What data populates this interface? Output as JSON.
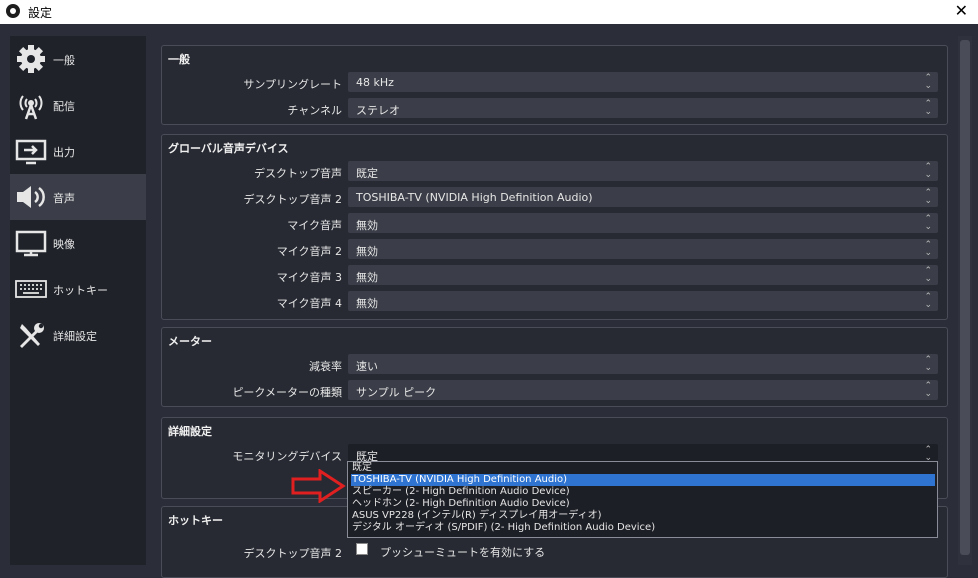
{
  "window": {
    "title": "設定",
    "close_label": "✕"
  },
  "sidebar": {
    "items": [
      {
        "label": "一般",
        "icon": "gear-icon"
      },
      {
        "label": "配信",
        "icon": "broadcast-icon"
      },
      {
        "label": "出力",
        "icon": "output-icon"
      },
      {
        "label": "音声",
        "icon": "speaker-icon"
      },
      {
        "label": "映像",
        "icon": "monitor-icon"
      },
      {
        "label": "ホットキー",
        "icon": "keyboard-icon"
      },
      {
        "label": "詳細設定",
        "icon": "tools-icon"
      }
    ],
    "active_index": 3
  },
  "groups": {
    "general": {
      "title": "一般",
      "rows": [
        {
          "label": "サンプリングレート",
          "value": "48 kHz"
        },
        {
          "label": "チャンネル",
          "value": "ステレオ"
        }
      ]
    },
    "global_audio": {
      "title": "グローバル音声デバイス",
      "rows": [
        {
          "label": "デスクトップ音声",
          "value": "既定"
        },
        {
          "label": "デスクトップ音声 2",
          "value": "TOSHIBA-TV (NVIDIA High Definition Audio)"
        },
        {
          "label": "マイク音声",
          "value": "無効"
        },
        {
          "label": "マイク音声 2",
          "value": "無効"
        },
        {
          "label": "マイク音声 3",
          "value": "無効"
        },
        {
          "label": "マイク音声 4",
          "value": "無効"
        }
      ]
    },
    "meter": {
      "title": "メーター",
      "rows": [
        {
          "label": "減衰率",
          "value": "速い"
        },
        {
          "label": "ピークメーターの種類",
          "value": "サンプル ピーク"
        }
      ]
    },
    "advanced": {
      "title": "詳細設定",
      "rows": [
        {
          "label": "モニタリングデバイス",
          "value": "既定"
        }
      ]
    },
    "hotkeys": {
      "title": "ホットキー",
      "rows": [
        {
          "label": "デスクトップ音声 2",
          "checkbox_label": "プッシューミュートを有効にする"
        }
      ]
    }
  },
  "dropdown": {
    "options": [
      "既定",
      "TOSHIBA-TV (NVIDIA High Definition Audio)",
      "スピーカー (2- High Definition Audio Device)",
      "ヘッドホン (2- High Definition Audio Device)",
      "ASUS VP228 (インテル(R) ディスプレイ用オーディオ)",
      "デジタル オーディオ (S/PDIF) (2- High Definition Audio Device)"
    ],
    "selected_index": 1
  },
  "colors": {
    "accent": "#2f74d0",
    "arrow": "#e02020",
    "background": "#2b2e38"
  }
}
